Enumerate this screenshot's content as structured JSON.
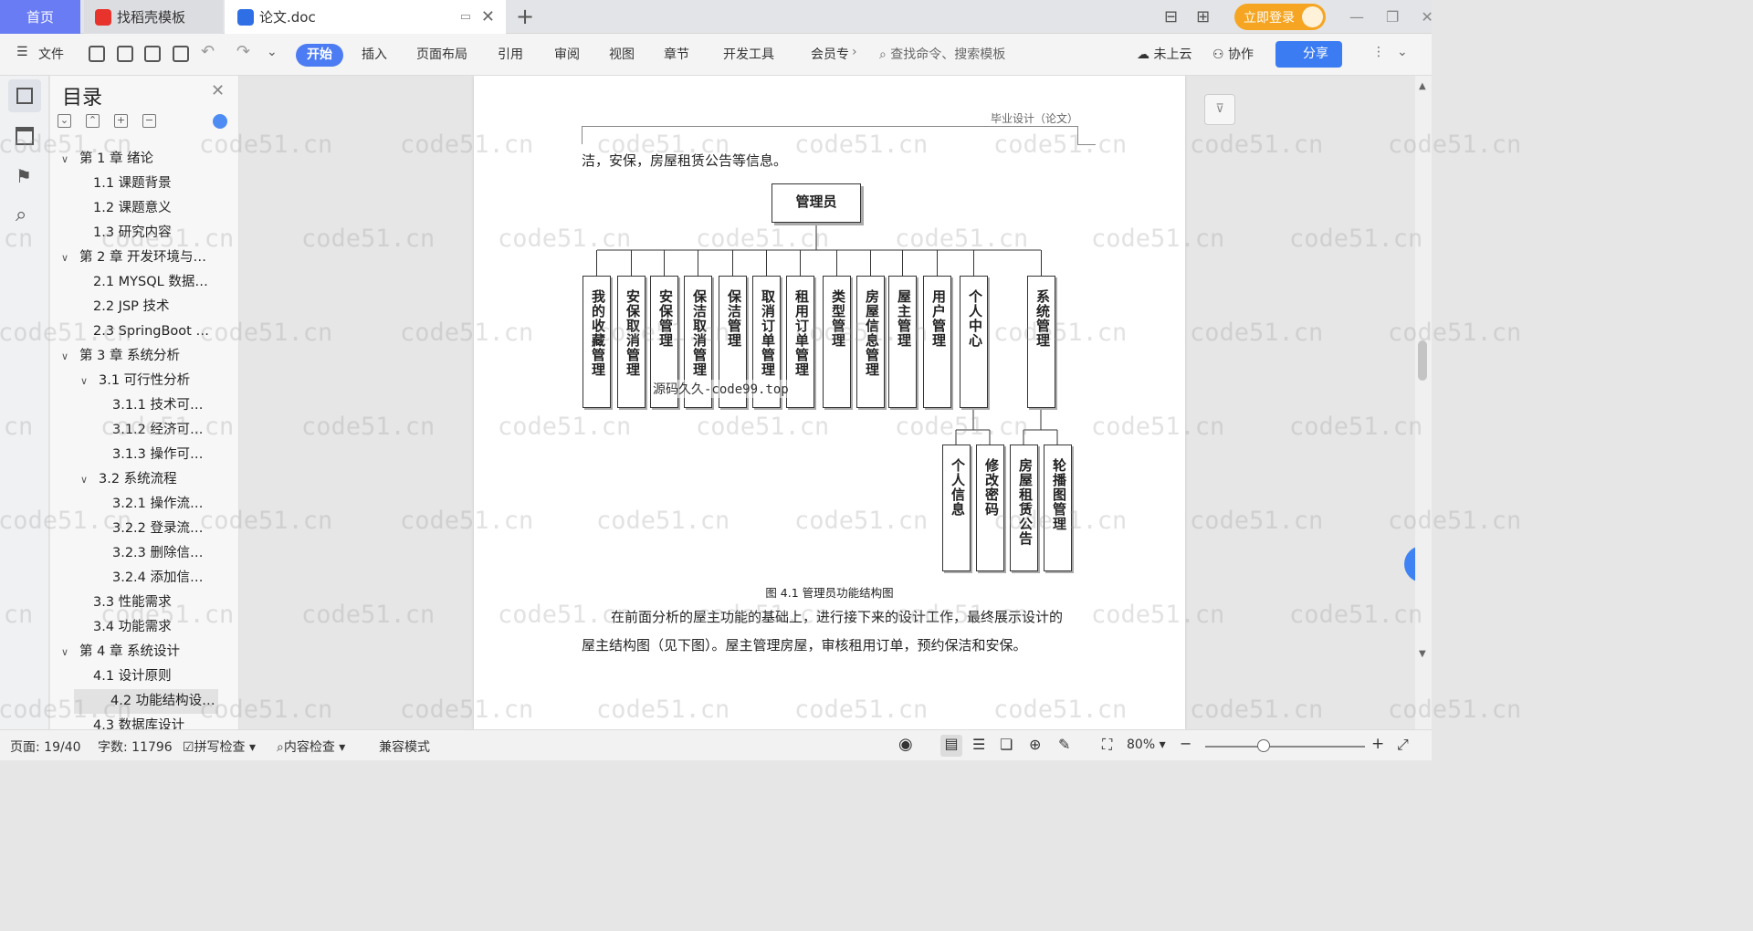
{
  "tabs": {
    "home": "首页",
    "template": "找稻壳模板",
    "doc": "论文.doc"
  },
  "login": "立即登录",
  "menu": {
    "file": "文件",
    "start": "开始",
    "insert": "插入",
    "layout": "页面布局",
    "ref": "引用",
    "review": "审阅",
    "view": "视图",
    "chapter": "章节",
    "dev": "开发工具",
    "member": "会员专",
    "search": "查找命令、搜索模板",
    "cloud": "未上云",
    "collab": "协作",
    "share": "分享"
  },
  "toc": {
    "title": "目录",
    "items": [
      {
        "label": "第 1 章  绪论",
        "level": 0,
        "arrow": "v"
      },
      {
        "label": "1.1  课题背景",
        "level": 1
      },
      {
        "label": "1.2  课题意义",
        "level": 1
      },
      {
        "label": "1.3  研究内容",
        "level": 1
      },
      {
        "label": "第 2 章  开发环境与…",
        "level": 0,
        "arrow": "v"
      },
      {
        "label": "2.1 MYSQL 数据…",
        "level": 1
      },
      {
        "label": "2.2 JSP 技术",
        "level": 1
      },
      {
        "label": "2.3 SpringBoot …",
        "level": 1
      },
      {
        "label": "第 3 章  系统分析",
        "level": 0,
        "arrow": "v"
      },
      {
        "label": "3.1  可行性分析",
        "level": 1,
        "arrow": "v"
      },
      {
        "label": "3.1.1  技术可…",
        "level": 2
      },
      {
        "label": "3.1.2  经济可…",
        "level": 2
      },
      {
        "label": "3.1.3  操作可…",
        "level": 2
      },
      {
        "label": "3.2  系统流程",
        "level": 1,
        "arrow": "v"
      },
      {
        "label": "3.2.1  操作流…",
        "level": 2
      },
      {
        "label": "3.2.2  登录流…",
        "level": 2
      },
      {
        "label": "3.2.3  删除信…",
        "level": 2
      },
      {
        "label": "3.2.4  添加信…",
        "level": 2
      },
      {
        "label": "3.3  性能需求",
        "level": 1
      },
      {
        "label": "3.4  功能需求",
        "level": 1
      },
      {
        "label": "第 4 章  系统设计",
        "level": 0,
        "arrow": "v"
      },
      {
        "label": "4.1  设计原则",
        "level": 1
      },
      {
        "label": "4.2  功能结构设…",
        "level": 1,
        "selected": true
      },
      {
        "label": "4.3  数据库设计",
        "level": 1
      }
    ]
  },
  "doc": {
    "header": "毕业设计（论文）",
    "top_line": "洁，安保，房屋租赁公告等信息。",
    "root": "管理员",
    "level1": [
      "我的收藏管理",
      "安保取消管理",
      "安保管理",
      "保洁取消管理",
      "保洁管理",
      "取消订单管理",
      "租用订单管理",
      "类型管理",
      "房屋信息管理",
      "屋主管理",
      "用户管理",
      "个人中心",
      "系统管理"
    ],
    "level2_personal": [
      "个人信息",
      "修改密码"
    ],
    "level2_system": [
      "房屋租赁公告",
      "轮播图管理"
    ],
    "overlay": "源码久久-code99.top",
    "caption": "图 4.1  管理员功能结构图",
    "para1": "在前面分析的屋主功能的基础上，进行接下来的设计工作，最终展示设计的",
    "para2": "屋主结构图（见下图）。屋主管理房屋，审核租用订单，预约保洁和安保。"
  },
  "status": {
    "page": "页面: 19/40",
    "words": "字数: 11796",
    "spell": "拼写检查",
    "content": "内容检查",
    "compat": "兼容模式",
    "zoom": "80%"
  },
  "watermark": "code51.cn"
}
